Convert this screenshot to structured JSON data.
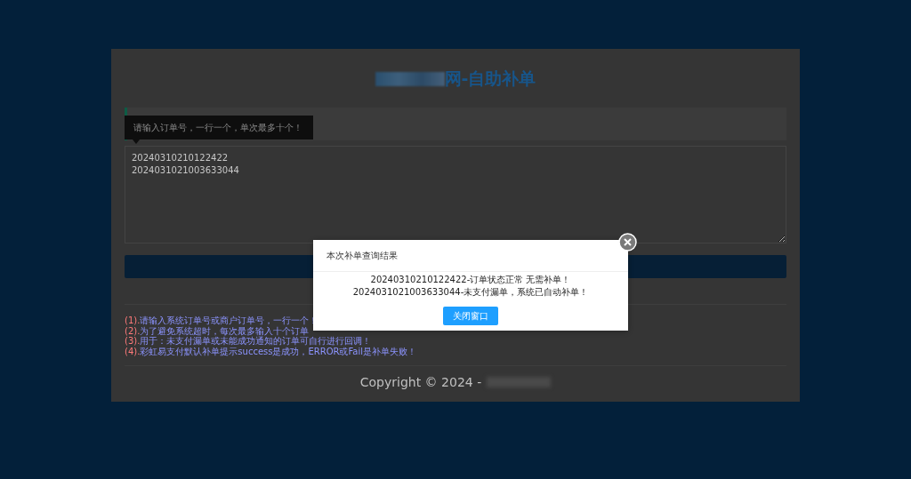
{
  "header": {
    "title": "网-自助补单"
  },
  "tooltip": {
    "text": "请输入订单号，一行一个，单次最多十个！"
  },
  "order_input": {
    "value": "20240310210122422\n2024031021003633044"
  },
  "notes": [
    {
      "number": "(1).",
      "text": "请输入系统订单号或商户订单号，一行一个！"
    },
    {
      "number": "(2).",
      "text": "为了避免系统超时，每次最多输入十个订单"
    },
    {
      "number": "(3).",
      "text": "用于：未支付漏单或未能成功通知的订单可自行进行回调！"
    },
    {
      "number": "(4).",
      "text": "彩虹易支付默认补单提示success是成功，ERROR或Fail是补单失败！"
    }
  ],
  "footer": {
    "copyright": "Copyright © 2024 -"
  },
  "dialog": {
    "title": "本次补单查询结果",
    "lines": [
      "20240310210122422-订单状态正常 无需补单！",
      "2024031021003633044-未支付漏单，系统已自动补单！"
    ],
    "button": "关闭窗口"
  }
}
